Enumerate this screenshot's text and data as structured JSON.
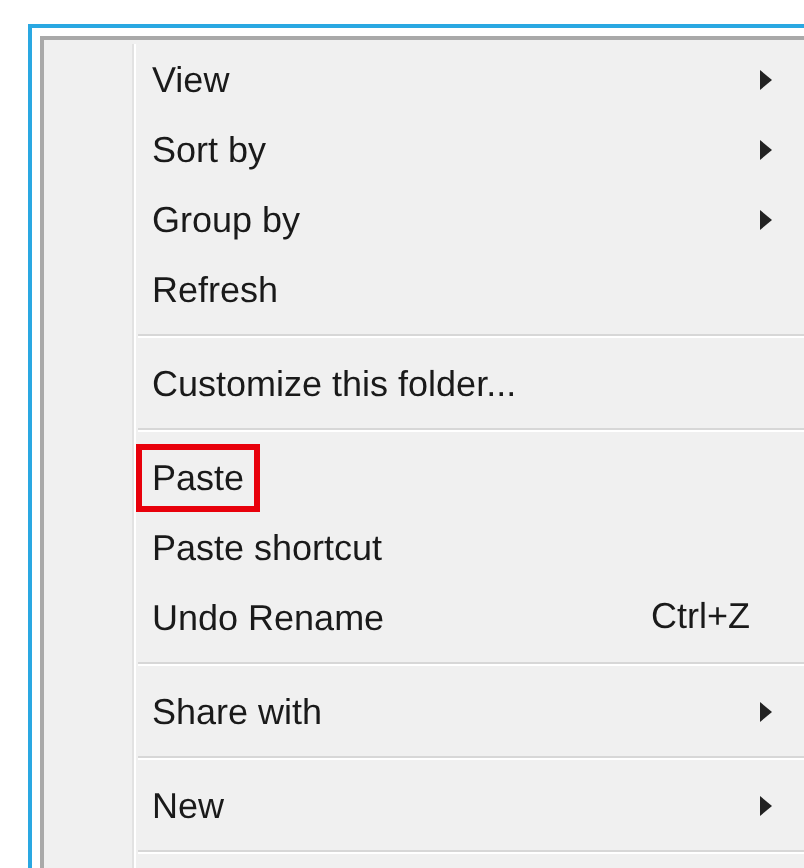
{
  "menu": {
    "items": [
      {
        "kind": "item",
        "label": "View",
        "submenu": true,
        "outlined": false
      },
      {
        "kind": "item",
        "label": "Sort by",
        "submenu": true,
        "outlined": false
      },
      {
        "kind": "item",
        "label": "Group by",
        "submenu": true,
        "outlined": false
      },
      {
        "kind": "item",
        "label": "Refresh",
        "submenu": false,
        "outlined": false
      },
      {
        "kind": "separator"
      },
      {
        "kind": "item",
        "label": "Customize this folder...",
        "submenu": false,
        "outlined": false
      },
      {
        "kind": "separator"
      },
      {
        "kind": "item",
        "label": "Paste",
        "submenu": false,
        "outlined": true
      },
      {
        "kind": "item",
        "label": "Paste shortcut",
        "submenu": false,
        "outlined": false
      },
      {
        "kind": "item",
        "label": "Undo Rename",
        "shortcut": "Ctrl+Z",
        "submenu": false,
        "outlined": false
      },
      {
        "kind": "separator"
      },
      {
        "kind": "item",
        "label": "Share with",
        "submenu": true,
        "outlined": false
      },
      {
        "kind": "separator"
      },
      {
        "kind": "item",
        "label": "New",
        "submenu": true,
        "outlined": false
      },
      {
        "kind": "separator"
      }
    ]
  }
}
